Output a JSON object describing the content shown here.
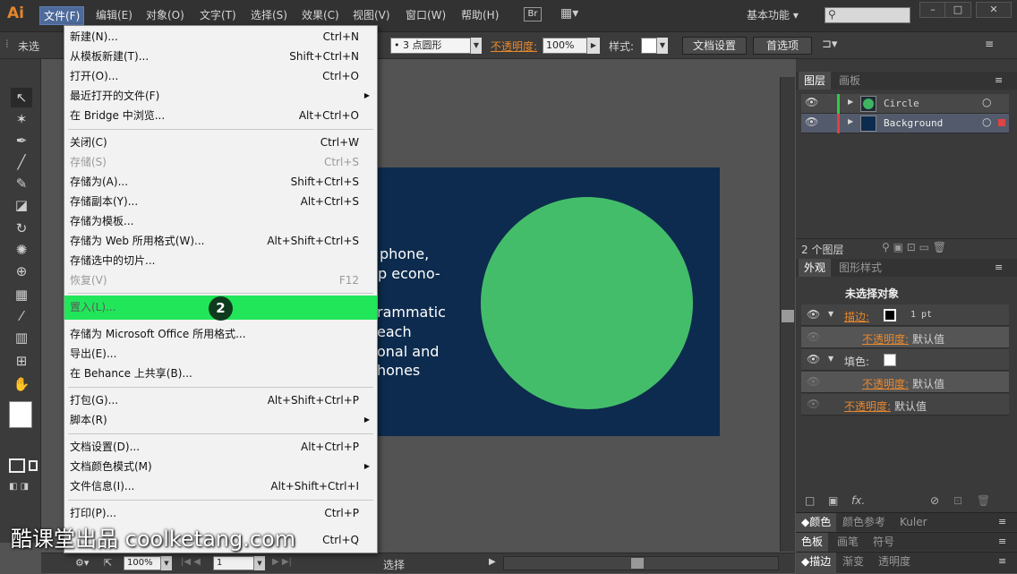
{
  "app": {
    "logo": "Ai"
  },
  "menubar": {
    "items": [
      "文件(F)",
      "编辑(E)",
      "对象(O)",
      "文字(T)",
      "选择(S)",
      "效果(C)",
      "视图(V)",
      "窗口(W)",
      "帮助(H)"
    ],
    "bridge": "Br",
    "workspace": "基本功能",
    "search_placeholder": ""
  },
  "control_bar": {
    "selection_label": "未选",
    "brush": "3 点圆形",
    "opacity_label": "不透明度:",
    "opacity_value": "100%",
    "style_label": "样式:",
    "doc_settings": "文档设置",
    "preferences": "首选项"
  },
  "file_menu": {
    "items": [
      {
        "label": "新建(N)...",
        "shortcut": "Ctrl+N"
      },
      {
        "label": "从模板新建(T)...",
        "shortcut": "Shift+Ctrl+N"
      },
      {
        "label": "打开(O)...",
        "shortcut": "Ctrl+O"
      },
      {
        "label": "最近打开的文件(F)",
        "shortcut": ""
      },
      {
        "label": "在 Bridge 中浏览...",
        "shortcut": "Alt+Ctrl+O"
      },
      {
        "label": "关闭(C)",
        "shortcut": "Ctrl+W"
      },
      {
        "label": "存储(S)",
        "shortcut": "Ctrl+S"
      },
      {
        "label": "存储为(A)...",
        "shortcut": "Shift+Ctrl+S"
      },
      {
        "label": "存储副本(Y)...",
        "shortcut": "Alt+Ctrl+S"
      },
      {
        "label": "存储为模板...",
        "shortcut": ""
      },
      {
        "label": "存储为 Web 所用格式(W)...",
        "shortcut": "Alt+Shift+Ctrl+S"
      },
      {
        "label": "存储选中的切片...",
        "shortcut": ""
      },
      {
        "label": "恢复(V)",
        "shortcut": "F12"
      },
      {
        "label": "置入(L)...",
        "shortcut": ""
      },
      {
        "label": "存储为 Microsoft Office 所用格式...",
        "shortcut": ""
      },
      {
        "label": "导出(E)...",
        "shortcut": ""
      },
      {
        "label": "在 Behance 上共享(B)...",
        "shortcut": ""
      },
      {
        "label": "打包(G)...",
        "shortcut": "Alt+Shift+Ctrl+P"
      },
      {
        "label": "脚本(R)",
        "shortcut": ""
      },
      {
        "label": "文档设置(D)...",
        "shortcut": "Alt+Ctrl+P"
      },
      {
        "label": "文档颜色模式(M)",
        "shortcut": ""
      },
      {
        "label": "文件信息(I)...",
        "shortcut": "Alt+Shift+Ctrl+I"
      },
      {
        "label": "打印(P)...",
        "shortcut": "Ctrl+P"
      },
      {
        "label": "",
        "shortcut": "Ctrl+Q"
      }
    ],
    "step_badge": "2"
  },
  "artboard": {
    "lines": [
      "phone,",
      "p econo-",
      "rammatic",
      "each",
      "onal and",
      "hones"
    ]
  },
  "layers_panel": {
    "tabs": [
      "图层",
      "画板"
    ],
    "layers": [
      {
        "name": "Circle",
        "color": "#2ecc40"
      },
      {
        "name": "Background",
        "color": "#e04040"
      }
    ],
    "count": "2 个图层"
  },
  "appearance_panel": {
    "tabs": [
      "外观",
      "图形样式"
    ],
    "header": "未选择对象",
    "stroke_label": "描边:",
    "stroke_value": "1 pt",
    "opacity_label": "不透明度:",
    "default": "默认值",
    "fill_label": "填色:"
  },
  "bottom_panels": {
    "row1": [
      "颜色",
      "颜色参考",
      "Kuler"
    ],
    "row2": [
      "色板",
      "画笔",
      "符号"
    ],
    "row3": [
      "描边",
      "渐变",
      "透明度"
    ]
  },
  "status_bar": {
    "zoom": "100%",
    "artboard": "1",
    "status": "选择"
  },
  "watermark": "酷课堂出品 coolketang.com"
}
